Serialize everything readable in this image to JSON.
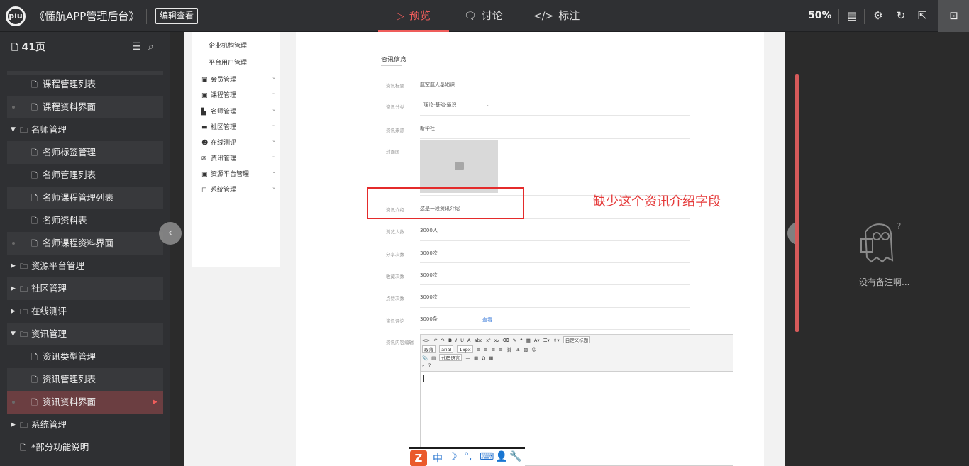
{
  "topbar": {
    "logo_text": "piu",
    "app_title": "《懂航APP管理后台》",
    "edit_button": "编辑查看",
    "tabs": [
      {
        "label": "预览",
        "icon": "play-icon"
      },
      {
        "label": "讨论",
        "icon": "comment-icon"
      },
      {
        "label": "标注",
        "icon": "code-icon"
      }
    ],
    "zoom": "50%",
    "accent_color": "#ef5d5b"
  },
  "sidebar": {
    "page_count": "41页",
    "items": [
      {
        "label": "课程管理列表",
        "level": 2
      },
      {
        "label": "课程资料界面",
        "level": 2
      },
      {
        "label": "名师管理",
        "level": 1,
        "expanded": true
      },
      {
        "label": "名师标签管理",
        "level": 2
      },
      {
        "label": "名师管理列表",
        "level": 2
      },
      {
        "label": "名师课程管理列表",
        "level": 2
      },
      {
        "label": "名师资料表",
        "level": 2
      },
      {
        "label": "名师课程资料界面",
        "level": 2
      },
      {
        "label": "资源平台管理",
        "level": 1,
        "expanded": false
      },
      {
        "label": "社区管理",
        "level": 1,
        "expanded": false
      },
      {
        "label": "在线测评",
        "level": 1,
        "expanded": false
      },
      {
        "label": "资讯管理",
        "level": 1,
        "expanded": true
      },
      {
        "label": "资讯类型管理",
        "level": 2
      },
      {
        "label": "资讯管理列表",
        "level": 2
      },
      {
        "label": "资讯资料界面",
        "level": 2,
        "selected": true
      },
      {
        "label": "系统管理",
        "level": 1,
        "expanded": false
      },
      {
        "label": "*部分功能说明",
        "level": 1
      }
    ]
  },
  "prototype": {
    "menu": {
      "plain": [
        "企业机构管理",
        "平台用户管理"
      ],
      "items": [
        "会员管理",
        "课程管理",
        "名师管理",
        "社区管理",
        "在线测评",
        "资讯管理",
        "资源平台管理",
        "系统管理"
      ]
    },
    "form": {
      "section_title": "资讯信息",
      "fields": [
        {
          "label": "资讯标题",
          "value": "航空航天基础课"
        },
        {
          "label": "资讯分类",
          "value": "理论·基础·通识"
        },
        {
          "label": "资讯来源",
          "value": "新华社"
        },
        {
          "label": "封面图",
          "value": ""
        },
        {
          "label": "资讯介绍",
          "value": "这是一段资讯介绍"
        },
        {
          "label": "浏览人数",
          "value": "3000人"
        },
        {
          "label": "分享次数",
          "value": "3000次"
        },
        {
          "label": "收藏次数",
          "value": "3000次"
        },
        {
          "label": "点赞次数",
          "value": "3000次"
        },
        {
          "label": "资讯评论",
          "value": "3000条"
        }
      ],
      "comment_link": "查看",
      "content_label": "资讯内容编辑",
      "editor_selects": [
        "自定义标题",
        "段落",
        "arial",
        "16px",
        "代码语言"
      ]
    }
  },
  "annotation": {
    "text": "缺少这个资讯介绍字段",
    "color": "#e42b2b"
  },
  "notes_panel": {
    "empty_text": "没有备注啊..."
  },
  "ime_bar": {
    "items": [
      "中",
      "☽",
      "°,",
      "⌨",
      "👤",
      "🔧"
    ]
  }
}
